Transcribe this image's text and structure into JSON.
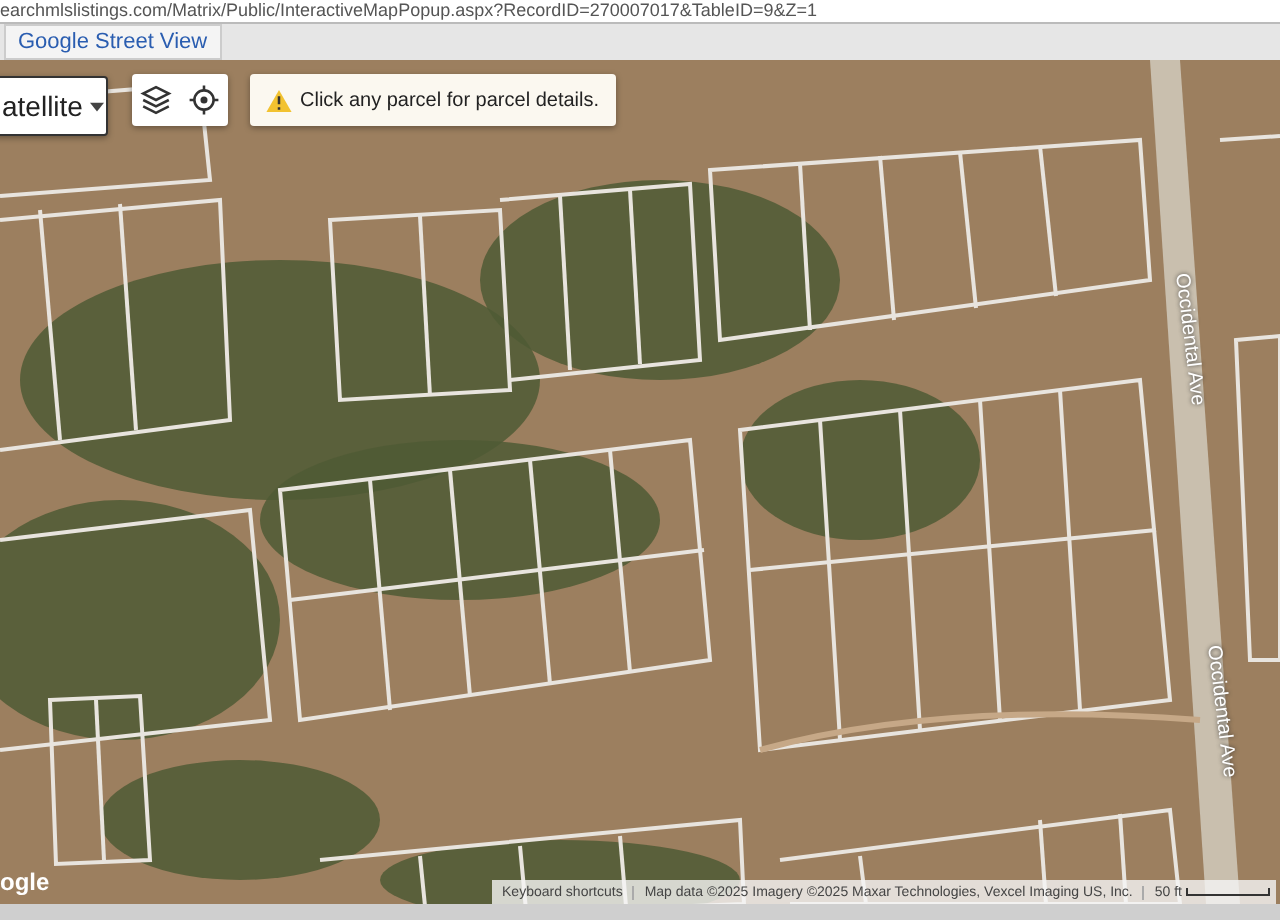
{
  "address_bar": {
    "url": "earchmlslistings.com/Matrix/Public/InteractiveMapPopup.aspx?RecordID=270007017&TableID=9&Z=1"
  },
  "tabs": [
    {
      "label": "Google Street View",
      "selected": true
    }
  ],
  "map": {
    "map_type": "atellite",
    "notice": "Click any parcel for parcel details.",
    "street_labels": [
      {
        "text": "Occidental Ave"
      },
      {
        "text": "Occidental Ave"
      }
    ],
    "logo": "ogle",
    "attribution": {
      "shortcuts": "Keyboard shortcuts",
      "data": "Map data ©2025 Imagery ©2025 Maxar Technologies, Vexcel Imaging US, Inc.",
      "scale": "50 ft"
    }
  }
}
